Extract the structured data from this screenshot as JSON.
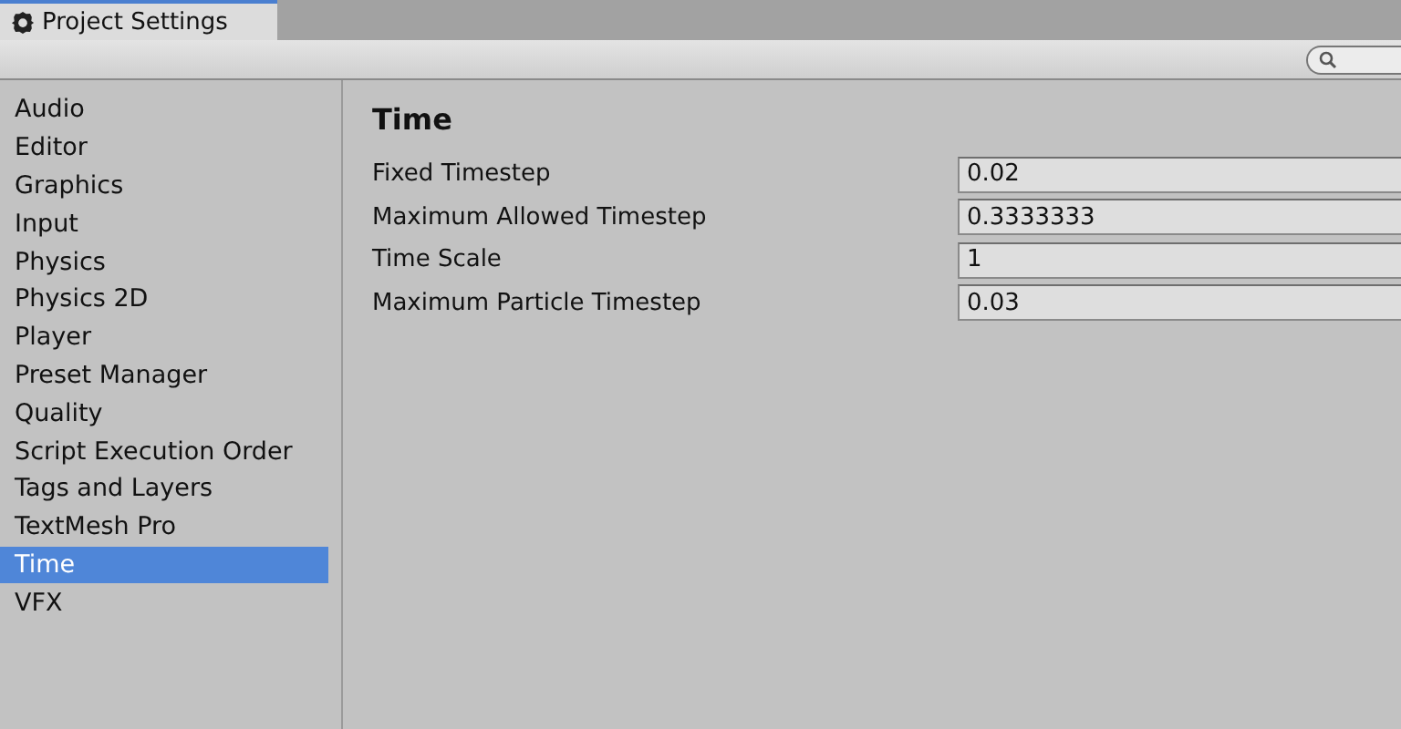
{
  "window": {
    "title": "Project Settings"
  },
  "sidebar": {
    "items": [
      {
        "label": "Audio",
        "selected": false
      },
      {
        "label": "Editor",
        "selected": false
      },
      {
        "label": "Graphics",
        "selected": false
      },
      {
        "label": "Input",
        "selected": false
      },
      {
        "label": "Physics",
        "selected": false
      },
      {
        "label": "Physics 2D",
        "selected": false
      },
      {
        "label": "Player",
        "selected": false
      },
      {
        "label": "Preset Manager",
        "selected": false
      },
      {
        "label": "Quality",
        "selected": false
      },
      {
        "label": "Script Execution Order",
        "selected": false
      },
      {
        "label": "Tags and Layers",
        "selected": false
      },
      {
        "label": "TextMesh Pro",
        "selected": false
      },
      {
        "label": "Time",
        "selected": true
      },
      {
        "label": "VFX",
        "selected": false
      }
    ]
  },
  "panel": {
    "title": "Time",
    "fields": [
      {
        "label": "Fixed Timestep",
        "value": "0.02"
      },
      {
        "label": "Maximum Allowed Timestep",
        "value": "0.3333333"
      },
      {
        "label": "Time Scale",
        "value": "1"
      },
      {
        "label": "Maximum Particle Timestep",
        "value": "0.03"
      }
    ]
  }
}
